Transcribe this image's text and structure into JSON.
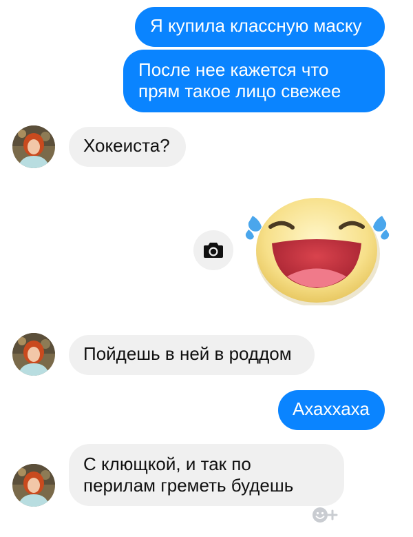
{
  "messages": {
    "m1": {
      "sender": "me",
      "text": "Я купила классную маску"
    },
    "m2": {
      "sender": "me",
      "line1": "После нее кажется что",
      "line2": "прям такое лицо свежее"
    },
    "m3": {
      "sender": "contact",
      "text": "Хокеиста?"
    },
    "m4": {
      "sender": "me",
      "sticker": "laughing-emoji-sticker"
    },
    "m5": {
      "sender": "contact",
      "text": "Пойдешь в ней в роддом"
    },
    "m6": {
      "sender": "me",
      "text": "Ахаххаха"
    },
    "m7": {
      "sender": "contact",
      "line1": "С клющкой, и так по",
      "line2": "перилам греметь будешь"
    }
  },
  "icons": {
    "camera": "camera-icon",
    "react": "add-reaction-icon",
    "avatar": "contact-avatar"
  },
  "colors": {
    "outgoing_bubble": "#0a84ff",
    "incoming_bubble": "#f0f0f0",
    "background": "#ffffff"
  }
}
